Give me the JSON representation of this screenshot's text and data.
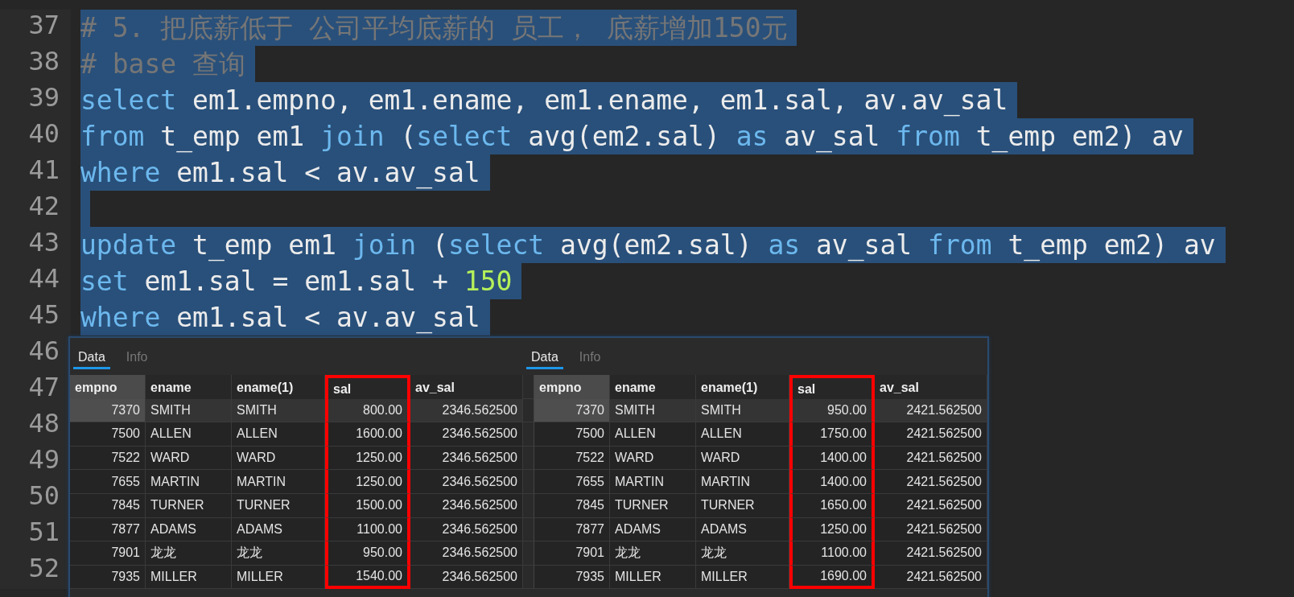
{
  "editor": {
    "lines": [
      {
        "number": "37",
        "selected": true,
        "tokens": [
          {
            "kind": "comment",
            "text": "# 5. 把底薪低于 公司平均底薪的 员工， 底薪增加150元"
          }
        ]
      },
      {
        "number": "38",
        "selected": true,
        "tokens": [
          {
            "kind": "comment",
            "text": "# base 查询"
          }
        ]
      },
      {
        "number": "39",
        "selected": true,
        "tokens": [
          {
            "kind": "keyword",
            "text": "select"
          },
          {
            "kind": "plain",
            "text": " em1.empno, em1.ename, em1.ename, em1.sal, av.av_sal"
          }
        ]
      },
      {
        "number": "40",
        "selected": true,
        "tokens": [
          {
            "kind": "keyword",
            "text": "from"
          },
          {
            "kind": "plain",
            "text": " t_emp em1 "
          },
          {
            "kind": "keyword",
            "text": "join"
          },
          {
            "kind": "plain",
            "text": " ("
          },
          {
            "kind": "keyword",
            "text": "select"
          },
          {
            "kind": "plain",
            "text": " avg(em2.sal) "
          },
          {
            "kind": "keyword",
            "text": "as"
          },
          {
            "kind": "plain",
            "text": " av_sal "
          },
          {
            "kind": "keyword",
            "text": "from"
          },
          {
            "kind": "plain",
            "text": " t_emp em2) av"
          }
        ]
      },
      {
        "number": "41",
        "selected": true,
        "tokens": [
          {
            "kind": "keyword",
            "text": "where"
          },
          {
            "kind": "plain",
            "text": " em1.sal < av.av_sal"
          }
        ]
      },
      {
        "number": "42",
        "selected": true
      },
      {
        "number": "43",
        "selected": true,
        "tokens": [
          {
            "kind": "keyword",
            "text": "update"
          },
          {
            "kind": "plain",
            "text": " t_emp em1 "
          },
          {
            "kind": "keyword",
            "text": "join"
          },
          {
            "kind": "plain",
            "text": " ("
          },
          {
            "kind": "keyword",
            "text": "select"
          },
          {
            "kind": "plain",
            "text": " avg(em2.sal) "
          },
          {
            "kind": "keyword",
            "text": "as"
          },
          {
            "kind": "plain",
            "text": " av_sal "
          },
          {
            "kind": "keyword",
            "text": "from"
          },
          {
            "kind": "plain",
            "text": " t_emp em2) av"
          }
        ]
      },
      {
        "number": "44",
        "selected": true,
        "tokens": [
          {
            "kind": "keyword",
            "text": "set"
          },
          {
            "kind": "plain",
            "text": " em1.sal = em1.sal + "
          },
          {
            "kind": "number",
            "text": "150"
          }
        ]
      },
      {
        "number": "45",
        "selected": true,
        "tokens": [
          {
            "kind": "keyword",
            "text": "where"
          },
          {
            "kind": "plain",
            "text": " em1.sal < av.av_sal"
          }
        ]
      },
      {
        "number": "46",
        "selected": false
      },
      {
        "number": "47",
        "selected": false
      },
      {
        "number": "48",
        "selected": false
      },
      {
        "number": "49",
        "selected": false
      },
      {
        "number": "50",
        "selected": false
      },
      {
        "number": "51",
        "selected": false
      },
      {
        "number": "52",
        "selected": false
      }
    ]
  },
  "result_panels": [
    {
      "row_header_column": false,
      "tabs": [
        {
          "label": "Data",
          "selected": true
        },
        {
          "label": "Info",
          "selected": false
        }
      ],
      "columns": [
        {
          "label": "empno",
          "kind": "number",
          "selected": true,
          "highlighted": false
        },
        {
          "label": "ename",
          "kind": "text",
          "selected": false,
          "highlighted": false
        },
        {
          "label": "ename(1)",
          "kind": "text",
          "selected": false,
          "highlighted": false
        },
        {
          "label": "sal",
          "kind": "number",
          "selected": false,
          "highlighted": true
        },
        {
          "label": "av_sal",
          "kind": "number",
          "selected": false,
          "highlighted": false
        }
      ],
      "rows": [
        {
          "selected": true,
          "cells": [
            "7370",
            "SMITH",
            "SMITH",
            "800.00",
            "2346.562500"
          ]
        },
        {
          "selected": false,
          "cells": [
            "7500",
            "ALLEN",
            "ALLEN",
            "1600.00",
            "2346.562500"
          ]
        },
        {
          "selected": false,
          "cells": [
            "7522",
            "WARD",
            "WARD",
            "1250.00",
            "2346.562500"
          ]
        },
        {
          "selected": false,
          "cells": [
            "7655",
            "MARTIN",
            "MARTIN",
            "1250.00",
            "2346.562500"
          ]
        },
        {
          "selected": false,
          "cells": [
            "7845",
            "TURNER",
            "TURNER",
            "1500.00",
            "2346.562500"
          ]
        },
        {
          "selected": false,
          "cells": [
            "7877",
            "ADAMS",
            "ADAMS",
            "1100.00",
            "2346.562500"
          ]
        },
        {
          "selected": false,
          "cells": [
            "7901",
            "龙龙",
            "龙龙",
            "950.00",
            "2346.562500"
          ]
        },
        {
          "selected": false,
          "cells": [
            "7935",
            "MILLER",
            "MILLER",
            "1540.00",
            "2346.562500"
          ]
        }
      ]
    },
    {
      "row_header_column": true,
      "tabs": [
        {
          "label": "Data",
          "selected": true
        },
        {
          "label": "Info",
          "selected": false
        }
      ],
      "columns": [
        {
          "label": "empno",
          "kind": "number",
          "selected": true,
          "highlighted": false
        },
        {
          "label": "ename",
          "kind": "text",
          "selected": false,
          "highlighted": false
        },
        {
          "label": "ename(1)",
          "kind": "text",
          "selected": false,
          "highlighted": false
        },
        {
          "label": "sal",
          "kind": "number",
          "selected": false,
          "highlighted": true
        },
        {
          "label": "av_sal",
          "kind": "number",
          "selected": false,
          "highlighted": false
        }
      ],
      "rows": [
        {
          "selected": true,
          "cells": [
            "7370",
            "SMITH",
            "SMITH",
            "950.00",
            "2421.562500"
          ]
        },
        {
          "selected": false,
          "cells": [
            "7500",
            "ALLEN",
            "ALLEN",
            "1750.00",
            "2421.562500"
          ]
        },
        {
          "selected": false,
          "cells": [
            "7522",
            "WARD",
            "WARD",
            "1400.00",
            "2421.562500"
          ]
        },
        {
          "selected": false,
          "cells": [
            "7655",
            "MARTIN",
            "MARTIN",
            "1400.00",
            "2421.562500"
          ]
        },
        {
          "selected": false,
          "cells": [
            "7845",
            "TURNER",
            "TURNER",
            "1650.00",
            "2421.562500"
          ]
        },
        {
          "selected": false,
          "cells": [
            "7877",
            "ADAMS",
            "ADAMS",
            "1250.00",
            "2421.562500"
          ]
        },
        {
          "selected": false,
          "cells": [
            "7901",
            "龙龙",
            "龙龙",
            "1100.00",
            "2421.562500"
          ]
        },
        {
          "selected": false,
          "cells": [
            "7935",
            "MILLER",
            "MILLER",
            "1690.00",
            "2421.562500"
          ]
        }
      ]
    }
  ]
}
